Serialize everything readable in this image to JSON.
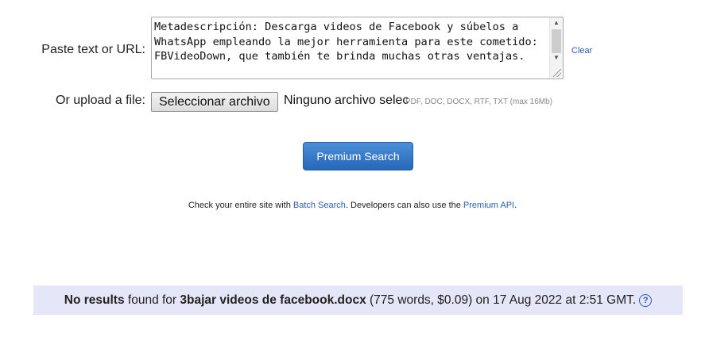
{
  "form": {
    "url_label": "Paste text or URL:",
    "textarea_value": "Metadescripción: Descarga videos de Facebook y súbelos a WhatsApp empleando la mejor herramienta para este cometido: FBVideoDown, que también te brinda muchas otras ventajas.",
    "clear_label": "Clear",
    "file_label": "Or upload a file:",
    "file_button_label": "Seleccionar archivo",
    "file_status": "Ninguno archivo selec",
    "file_hint": "PDF, DOC, DOCX, RTF, TXT (max 16Mb)",
    "premium_button_label": "Premium Search"
  },
  "info": {
    "prefix": "Check your entire site with ",
    "batch_link": "Batch Search",
    "middle": ". Developers can also use the ",
    "api_link": "Premium API",
    "suffix": "."
  },
  "results": {
    "bold_status": "No results",
    "text_1": " found for ",
    "filename": "3bajar videos de facebook.docx",
    "text_2": " (775 words, $0.09) on 17 Aug 2022 at 2:51 GMT.",
    "help_glyph": "?"
  },
  "colors": {
    "link": "#2a5db0",
    "button": "#2667b8",
    "results_bg": "#e6e6f9"
  }
}
